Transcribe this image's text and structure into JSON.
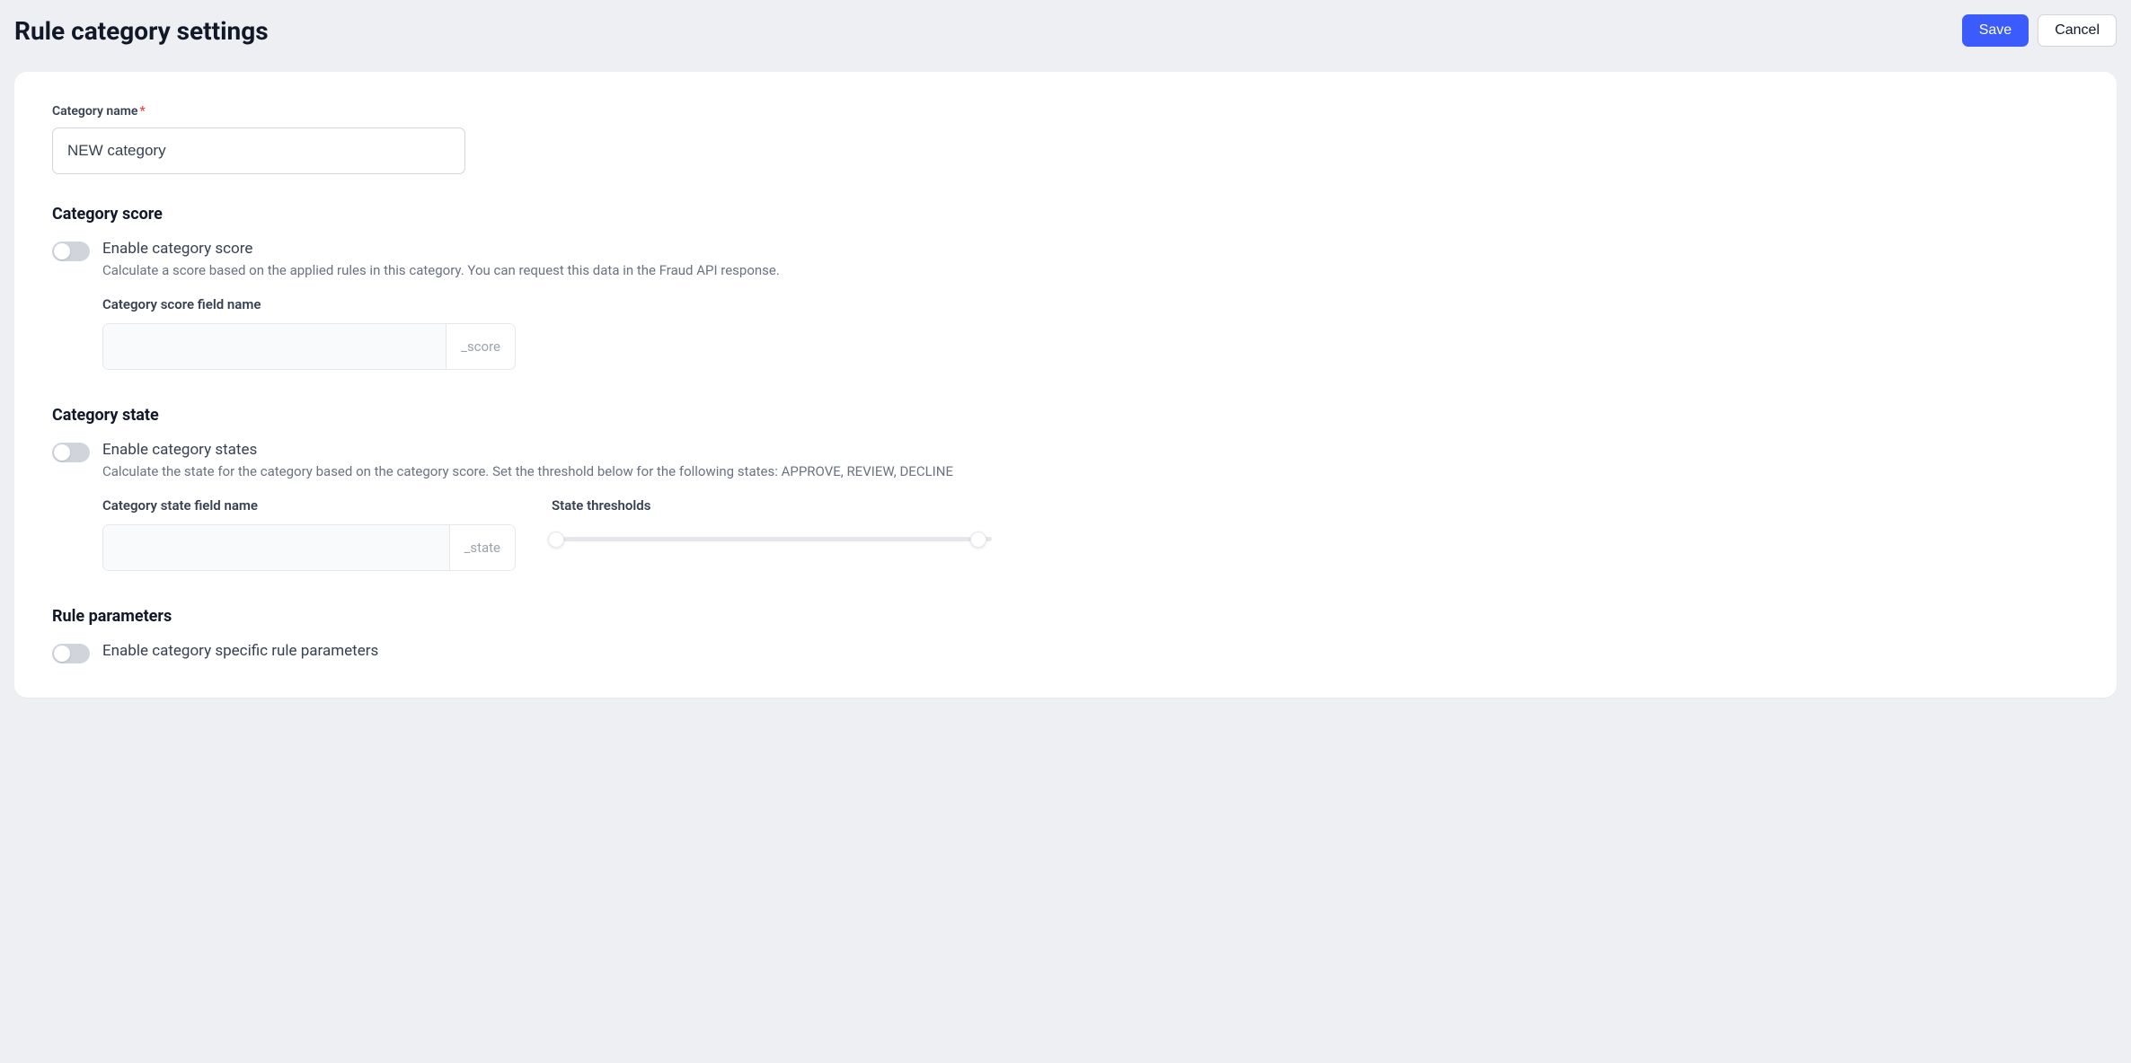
{
  "header": {
    "title": "Rule category settings",
    "save_label": "Save",
    "cancel_label": "Cancel"
  },
  "category_name": {
    "label": "Category name",
    "value": "NEW category"
  },
  "category_score": {
    "heading": "Category score",
    "toggle_label": "Enable category score",
    "description": "Calculate a score based on the applied rules in this category. You can request this data in the Fraud API response.",
    "field_label": "Category score field name",
    "field_value": "",
    "suffix": "_score",
    "enabled": false
  },
  "category_state": {
    "heading": "Category state",
    "toggle_label": "Enable category states",
    "description": "Calculate the state for the category based on the category score. Set the threshold below for the following states: APPROVE, REVIEW, DECLINE",
    "field_label": "Category state field name",
    "field_value": "",
    "suffix": "_state",
    "thresholds_label": "State thresholds",
    "enabled": false
  },
  "rule_parameters": {
    "heading": "Rule parameters",
    "toggle_label": "Enable category specific rule parameters",
    "enabled": false
  }
}
